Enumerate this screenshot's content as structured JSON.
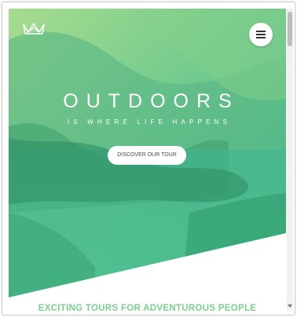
{
  "hero": {
    "title": "OUTDOORS",
    "subtitle": "IS WHERE LIFE HAPPENS",
    "cta_label": "DISCOVER OUR TOUR",
    "logo_icon": "crown-icon",
    "menu_icon": "hamburger-menu-icon"
  },
  "section": {
    "title": "EXCITING TOURS FOR ADVENTUROUS PEOPLE"
  },
  "colors": {
    "accent": "#7ccf8f",
    "hero_overlay_light": "#7ed56f",
    "hero_overlay_dark": "#28b485"
  }
}
